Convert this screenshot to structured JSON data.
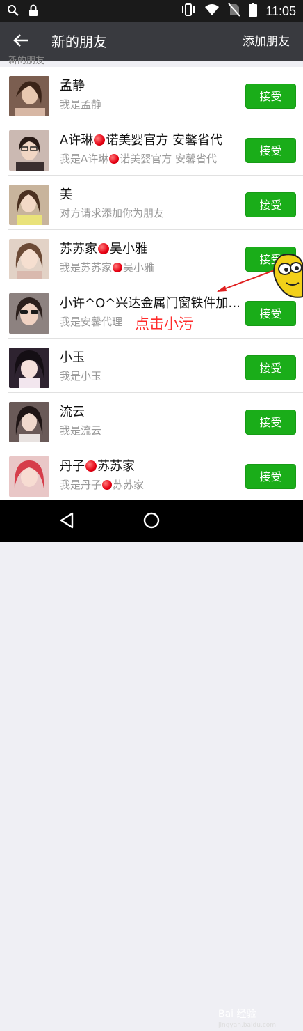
{
  "status_bar": {
    "time": "11:05",
    "icons": [
      "search-icon",
      "lock-icon",
      "vibrate-icon",
      "wifi-icon",
      "no-sim-icon",
      "battery-icon"
    ]
  },
  "app_bar": {
    "title": "新的朋友",
    "action_label": "添加朋友"
  },
  "section_label": "新的朋友",
  "requests": [
    {
      "name": "孟静",
      "message": "我是孟静",
      "accept_label": "接受",
      "avatar_color": "#8a6a5a"
    },
    {
      "name_parts": [
        "A许琳",
        "诺美婴官方 安馨省代"
      ],
      "message_parts": [
        "我是A许琳",
        "诺美婴官方 安馨省代"
      ],
      "accept_label": "接受",
      "avatar_color": "#c9b6b0"
    },
    {
      "name": "美",
      "message": "对方请求添加你为朋友",
      "accept_label": "接受",
      "avatar_color": "#b8a28a"
    },
    {
      "name_parts": [
        "苏苏家",
        "吴小雅"
      ],
      "message_parts": [
        "我是苏苏家",
        "吴小雅"
      ],
      "accept_label": "接受",
      "avatar_color": "#d9c2b4"
    },
    {
      "name": "小许^O^兴达金属门窗铁件加…",
      "message": "我是安馨代理",
      "accept_label": "接受",
      "avatar_color": "#7d6f6c"
    },
    {
      "name": "小玉",
      "message": "我是小玉",
      "accept_label": "接受",
      "avatar_color": "#3a2c3c"
    },
    {
      "name": "流云",
      "message": "我是流云",
      "accept_label": "接受",
      "avatar_color": "#5a4a48"
    },
    {
      "name_parts": [
        "丹子",
        "苏苏家"
      ],
      "message_parts": [
        "我是丹子",
        "苏苏家"
      ],
      "accept_label": "接受",
      "avatar_color": "#d46060"
    }
  ],
  "annotation": "点击小污",
  "watermark": {
    "text": "Bai 经验",
    "sub": "jingyan.baidu.com"
  },
  "colors": {
    "accept_green": "#1aad19",
    "app_bar": "#393a3f",
    "annotation_red": "#ff2a2a"
  }
}
